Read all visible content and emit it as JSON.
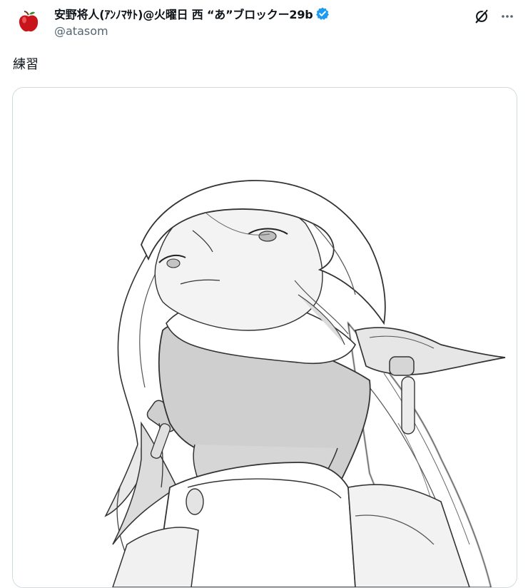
{
  "author": {
    "display_name": "安野将人(ｱﾝﾉﾏｻﾄ)@火曜日 西 “あ”ブロックー29b",
    "handle": "@atasom",
    "verified": true,
    "avatar_icon": "apple-icon",
    "badge_color": "#1d9bf0"
  },
  "header_actions": {
    "grok_icon": "grok-icon",
    "more_icon": "more-icon"
  },
  "tweet": {
    "text": "練習"
  },
  "media": {
    "kind": "illustration",
    "description_icon": "sketch-image"
  },
  "colors": {
    "text": "#0f1419",
    "secondary": "#536471",
    "border": "#cfd9de",
    "verified": "#1d9bf0",
    "avatar_red": "#c8151b"
  }
}
